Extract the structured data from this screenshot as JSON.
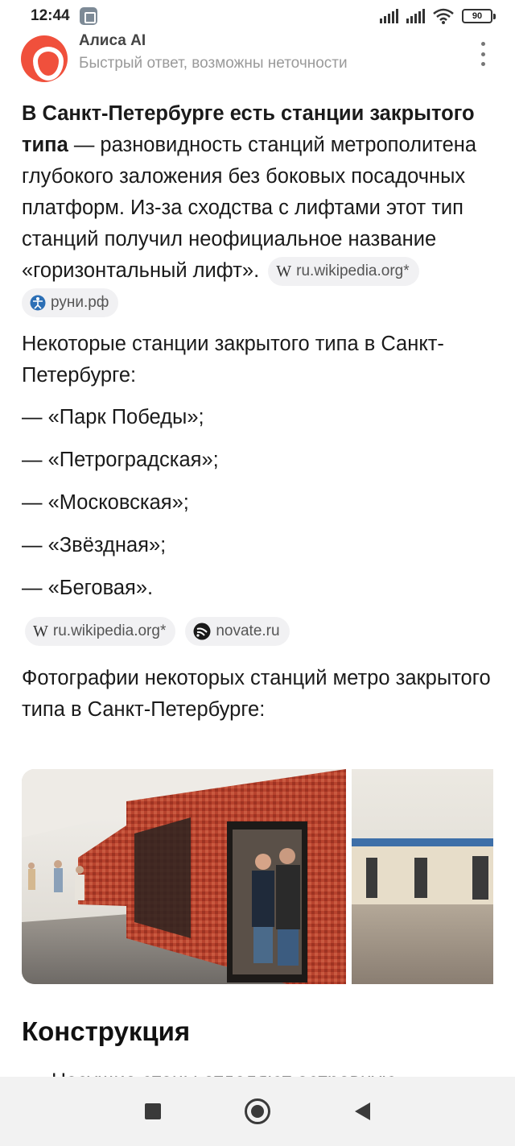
{
  "status_bar": {
    "time": "12:44",
    "battery": "90"
  },
  "header": {
    "title": "Алиса AI",
    "subtitle": "Быстрый ответ, возможны неточности"
  },
  "answer": {
    "p1_bold": "В Санкт-Петербурге есть станции закрытого типа",
    "p1_text": " — разновидность станций метрополитена глубокого заложения без боковых посадочных платформ. Из-за сходства с лифтами этот тип станций получил неофициальное название «горизонтальный лифт».",
    "p1_sources": [
      {
        "label": "ru.wikipedia.org*",
        "icon": "wikipedia-icon"
      },
      {
        "label": "руни.рф",
        "icon": "runi-icon"
      }
    ],
    "p2": "Некоторые станции закрытого типа в Санкт-Петербурге:",
    "stations": [
      "— «Парк Победы»;",
      "— «Петроградская»;",
      "— «Московская»;",
      "— «Звёздная»;",
      "— «Беговая»."
    ],
    "p2_sources": [
      {
        "label": "ru.wikipedia.org*",
        "icon": "wikipedia-icon"
      },
      {
        "label": "novate.ru",
        "icon": "novate-icon"
      }
    ],
    "p3": "Фотографии некоторых станций метро закрытого типа в Санкт-Петербурге:",
    "section_heading": "Конструкция",
    "cut_text": "Несущие стены отделяют островную"
  },
  "colors": {
    "alice_logo": "#f0503c",
    "chip_bg": "#f1f1f3",
    "nav_bg": "#f2f2f2"
  }
}
